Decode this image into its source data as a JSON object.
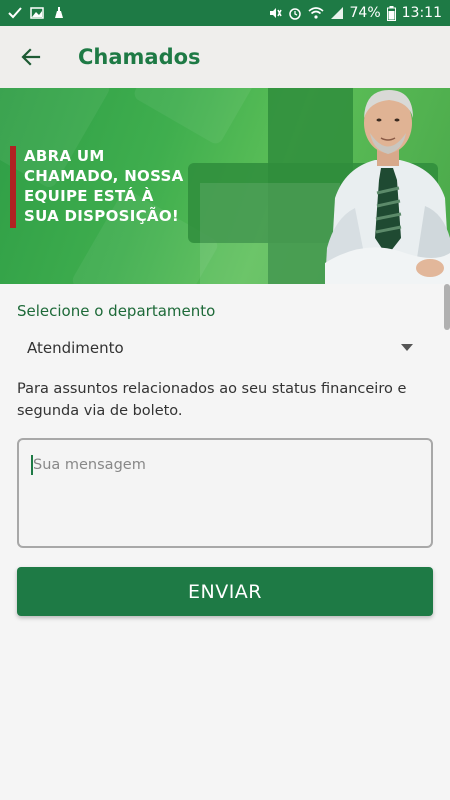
{
  "status_bar": {
    "battery": "74%",
    "time": "13:11"
  },
  "app_bar": {
    "title": "Chamados"
  },
  "banner": {
    "lines": [
      "ABRA UM",
      "CHAMADO, NOSSA",
      "EQUIPE ESTÁ À",
      "SUA DISPOSIÇÃO!"
    ]
  },
  "form": {
    "department_label": "Selecione o departamento",
    "department_value": "Atendimento",
    "info": "Para assuntos relacionados ao seu status financeiro e segunda via de boleto.",
    "message_placeholder": "Sua mensagem",
    "send_label": "ENVIAR"
  },
  "colors": {
    "primary": "#1e7a45",
    "accent_red": "#b02222"
  },
  "icons": {
    "back": "arrow-back-icon",
    "dropdown": "chevron-down-icon"
  }
}
